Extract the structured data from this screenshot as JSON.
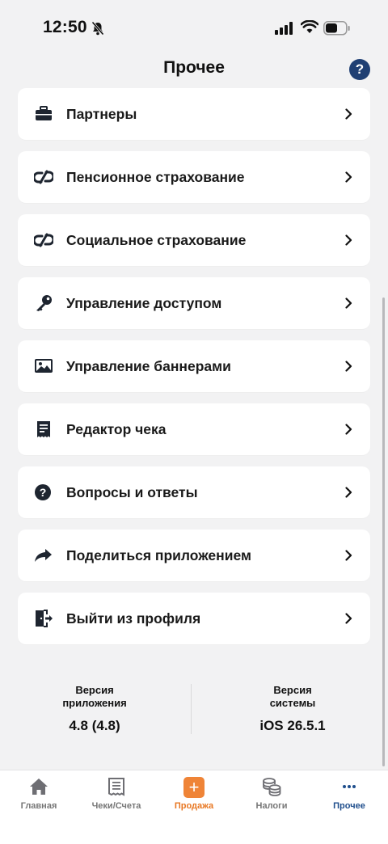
{
  "status_bar": {
    "time": "12:50"
  },
  "header": {
    "title": "Прочее",
    "help_label": "?"
  },
  "menu": [
    {
      "label": "Партнеры",
      "icon": "briefcase-icon"
    },
    {
      "label": "Пенсионное страхование",
      "icon": "link-icon"
    },
    {
      "label": "Социальное страхование",
      "icon": "link-icon"
    },
    {
      "label": "Управление доступом",
      "icon": "key-icon"
    },
    {
      "label": "Управление баннерами",
      "icon": "image-icon"
    },
    {
      "label": "Редактор чека",
      "icon": "receipt-icon"
    },
    {
      "label": "Вопросы и ответы",
      "icon": "question-circle-icon"
    },
    {
      "label": "Поделиться приложением",
      "icon": "share-arrow-icon"
    },
    {
      "label": "Выйти из профиля",
      "icon": "logout-icon"
    }
  ],
  "versions": {
    "app": {
      "label": "Версия\nприложения",
      "value": "4.8 (4.8)"
    },
    "system": {
      "label": "Версия\nсистемы",
      "value": "iOS 26.5.1"
    }
  },
  "tabbar": [
    {
      "label": "Главная",
      "icon": "home-icon"
    },
    {
      "label": "Чеки/Счета",
      "icon": "receipt-icon"
    },
    {
      "label": "Продажа",
      "icon": "plus-icon",
      "value": "+"
    },
    {
      "label": "Налоги",
      "icon": "coins-icon"
    },
    {
      "label": "Прочее",
      "icon": "more-icon"
    }
  ],
  "colors": {
    "accent": "#1f4e8c",
    "sale": "#e87722",
    "help": "#1f3f73",
    "background": "#f2f2f3"
  }
}
